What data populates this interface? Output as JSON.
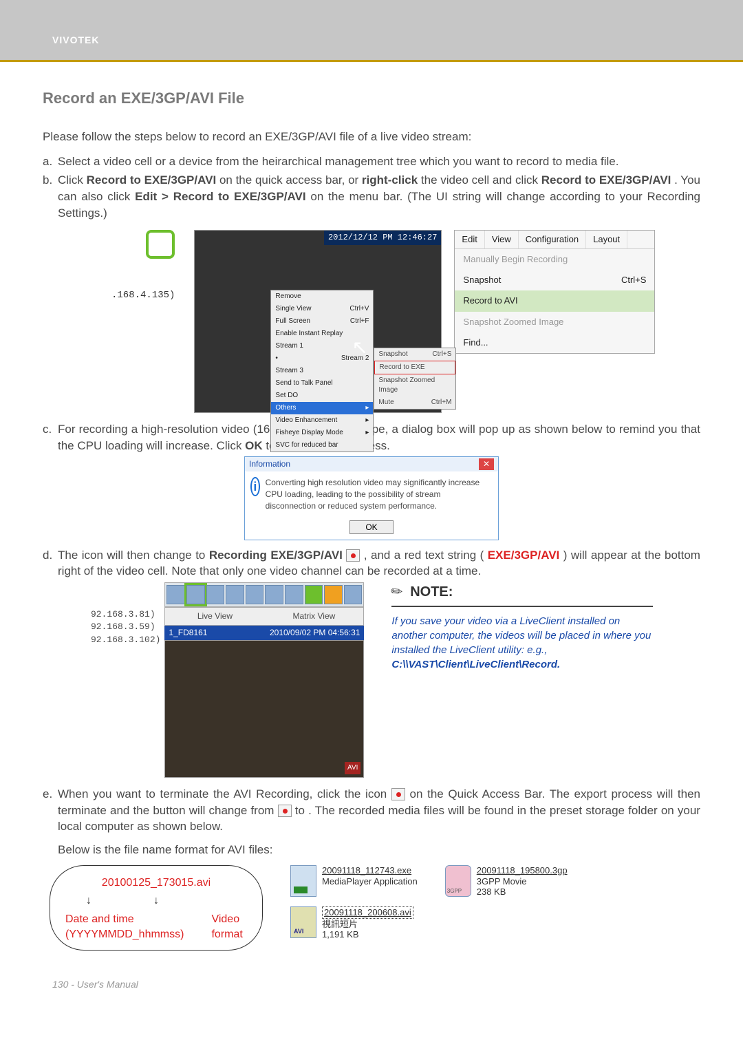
{
  "brand": "VIVOTEK",
  "title": "Record an EXE/3GP/AVI File",
  "intro": "Please follow the steps below to record an EXE/3GP/AVI file of a live video stream:",
  "steps": {
    "a": {
      "label": "a.",
      "text_before": "Select a video cell or a device from the heirarchical management tree which you want to record to media file."
    },
    "b": {
      "label": "b.",
      "t1": "Click ",
      "bold1": "Record to EXE/3GP/AVI",
      "t2": " on the quick access bar, or ",
      "bold2": "right-click",
      "t3": " the video cell and click ",
      "bold3": "Record to EXE/3GP/AVI",
      "t4": ". You can also click ",
      "bold4": "Edit > Record to EXE/3GP/AVI",
      "t5": " on the menu bar. (The UI string will change according to your Recording Settings.)"
    },
    "c": {
      "label": "c.",
      "t1": "For recording a high-resolution video (1600 x 1200) in AVI type, a dialog box will pop up as shown below to remind you that the CPU loading will increase. Click ",
      "bold1": "OK",
      "t2": " to continue the process."
    },
    "d": {
      "label": "d.",
      "t1": "The icon     will then change to ",
      "bold1": "Recording EXE/3GP/AVI",
      "t2": " , and a red text string (",
      "red1": "EXE/3GP/AVI",
      "t3": ") will appear at the bottom right of the video cell. Note that only one video channel can be recorded at a time."
    },
    "e": {
      "label": "e.",
      "t1": "When you want to terminate the AVI Recording, click the icon ",
      "t2": " on the Quick Access Bar. The export process will then terminate and the button will change from ",
      "t3": " to      . The recorded media files will be found in the preset storage folder on your local computer as shown below.",
      "below": "Below is the file name format for AVI files:"
    }
  },
  "ip_fig": ".168.4.135)",
  "video": {
    "timestamp": "2012/12/12 PM 12:46:27",
    "ctx": {
      "remove": "Remove",
      "single": "Single View",
      "single_sc": "Ctrl+V",
      "full": "Full Screen",
      "full_sc": "Ctrl+F",
      "enable": "Enable Instant Replay",
      "s1": "Stream 1",
      "s2": "Stream 2",
      "s3": "Stream 3",
      "talk": "Send to Talk Panel",
      "setdo": "Set DO",
      "others": "Others",
      "video_enh": "Video Enhancement",
      "fisheye": "Fisheye Display Mode",
      "svc": "SVC for reduced bar"
    },
    "sub": {
      "snapshot": "Snapshot",
      "snap_sc": "Ctrl+S",
      "record_exe": "Record to EXE",
      "print_zoom": "Snapshot Zoomed Image",
      "mute": "Mute",
      "mute_sc": "Ctrl+M"
    }
  },
  "edit_menu": {
    "tabs": [
      "Edit",
      "View",
      "Configuration",
      "Layout"
    ],
    "items": {
      "manual": "Manually Begin Recording",
      "snapshot": "Snapshot",
      "snap_sc": "Ctrl+S",
      "record_avi": "Record to AVI",
      "zoom": "Snapshot Zoomed Image",
      "find": "Find..."
    }
  },
  "dialog": {
    "title": "Information",
    "msg": "Converting high resolution video may significantly increase CPU loading, leading to the possibility of stream disconnection or reduced system performance.",
    "ok": "OK"
  },
  "toolbar_fig": {
    "tabs": [
      "Live View",
      "Matrix View"
    ],
    "header_left": "1_FD8161",
    "header_right": "2010/09/02 PM 04:56:31",
    "avi_tag": "AVI",
    "ips": [
      "92.168.3.81)",
      "92.168.3.59)",
      "92.168.3.102)"
    ]
  },
  "note": {
    "title": "NOTE:",
    "body_1": "If you save your video via a LiveClient installed on another computer, the videos will be placed in where you installed the LiveClient utility: e.g., ",
    "path": "C:\\\\VAST\\Client\\LiveClient\\Record."
  },
  "file_format": {
    "name_red1": "20100125_173015",
    "name_red2": ".avi",
    "arrow": "↓",
    "date_label": "Date and time",
    "date_sub": "(YYYYMMDD_hhmmss)",
    "format_label": "Video format"
  },
  "files": {
    "exe": {
      "name": "20091118_112743.exe",
      "desc": "MediaPlayer Application"
    },
    "avi": {
      "name": "20091118_200608.avi",
      "desc": "視訊短片",
      "size": "1,191 KB"
    },
    "gpp": {
      "name": "20091118_195800.3gp",
      "desc": "3GPP Movie",
      "size": "238 KB"
    }
  },
  "footer": "130 - User's Manual"
}
